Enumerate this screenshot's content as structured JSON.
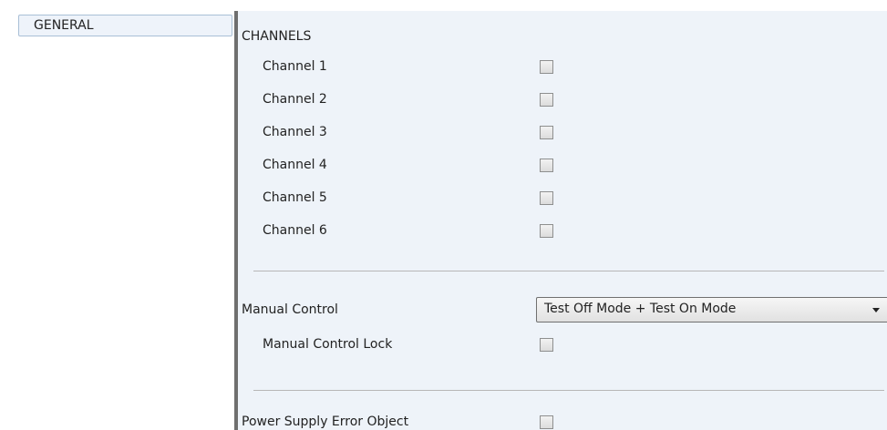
{
  "sidebar": {
    "items": [
      {
        "label": "GENERAL"
      }
    ]
  },
  "channels": {
    "heading": "CHANNELS",
    "items": [
      {
        "label": "Channel 1",
        "checked": false
      },
      {
        "label": "Channel 2",
        "checked": false
      },
      {
        "label": "Channel 3",
        "checked": false
      },
      {
        "label": "Channel 4",
        "checked": false
      },
      {
        "label": "Channel 5",
        "checked": false
      },
      {
        "label": "Channel 6",
        "checked": false
      }
    ]
  },
  "manual_control": {
    "label": "Manual Control",
    "value": "Test Off Mode + Test On Mode",
    "lock_label": "Manual Control Lock",
    "lock_checked": false
  },
  "power_supply": {
    "label": "Power Supply Error Object",
    "checked": false
  }
}
